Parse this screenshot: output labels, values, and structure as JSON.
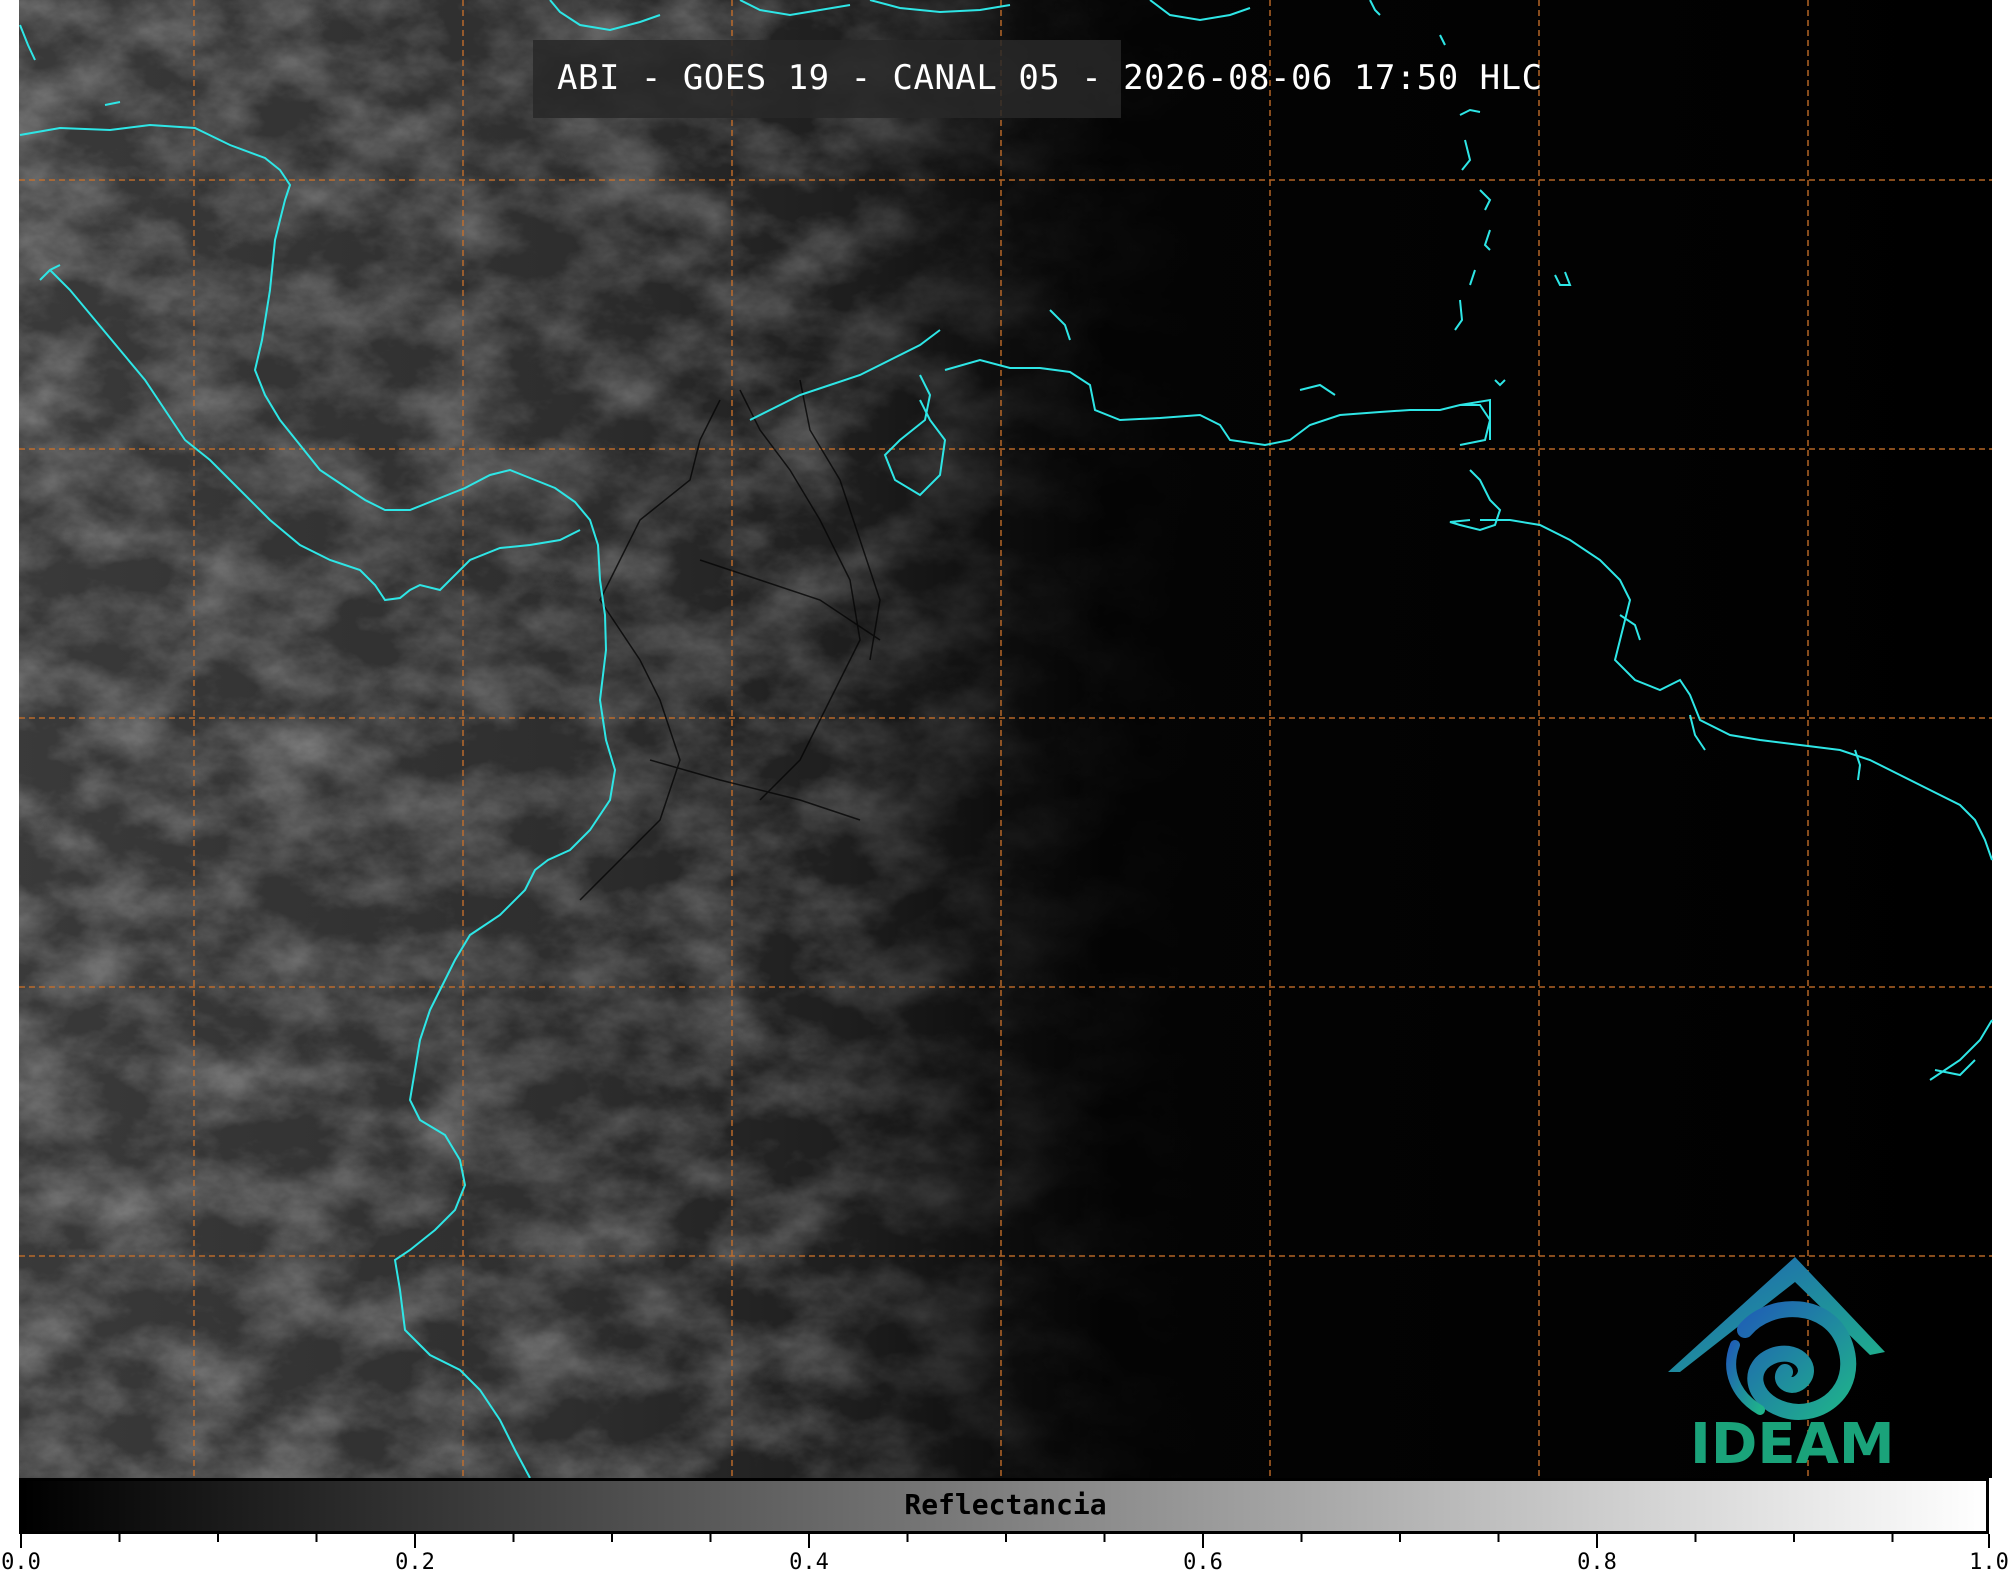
{
  "title": "ABI - GOES 19 - CANAL 05 - 2026-08-06 17:50 HLC",
  "colorbar": {
    "label": "Reflectancia",
    "ticks": [
      "0.0",
      "0.2",
      "0.4",
      "0.6",
      "0.8",
      "1.0"
    ],
    "range": [
      0.0,
      1.0
    ],
    "colors": {
      "start": "#000000",
      "end": "#ffffff"
    }
  },
  "logo": {
    "text": "IDEAM",
    "color": "#1aa37a",
    "icon": "ideam-logo-icon"
  },
  "map": {
    "coastline_color": "#2ee6e6",
    "grid_color": "#c8702a",
    "background": "#000000",
    "grid_lines": "dashed"
  }
}
